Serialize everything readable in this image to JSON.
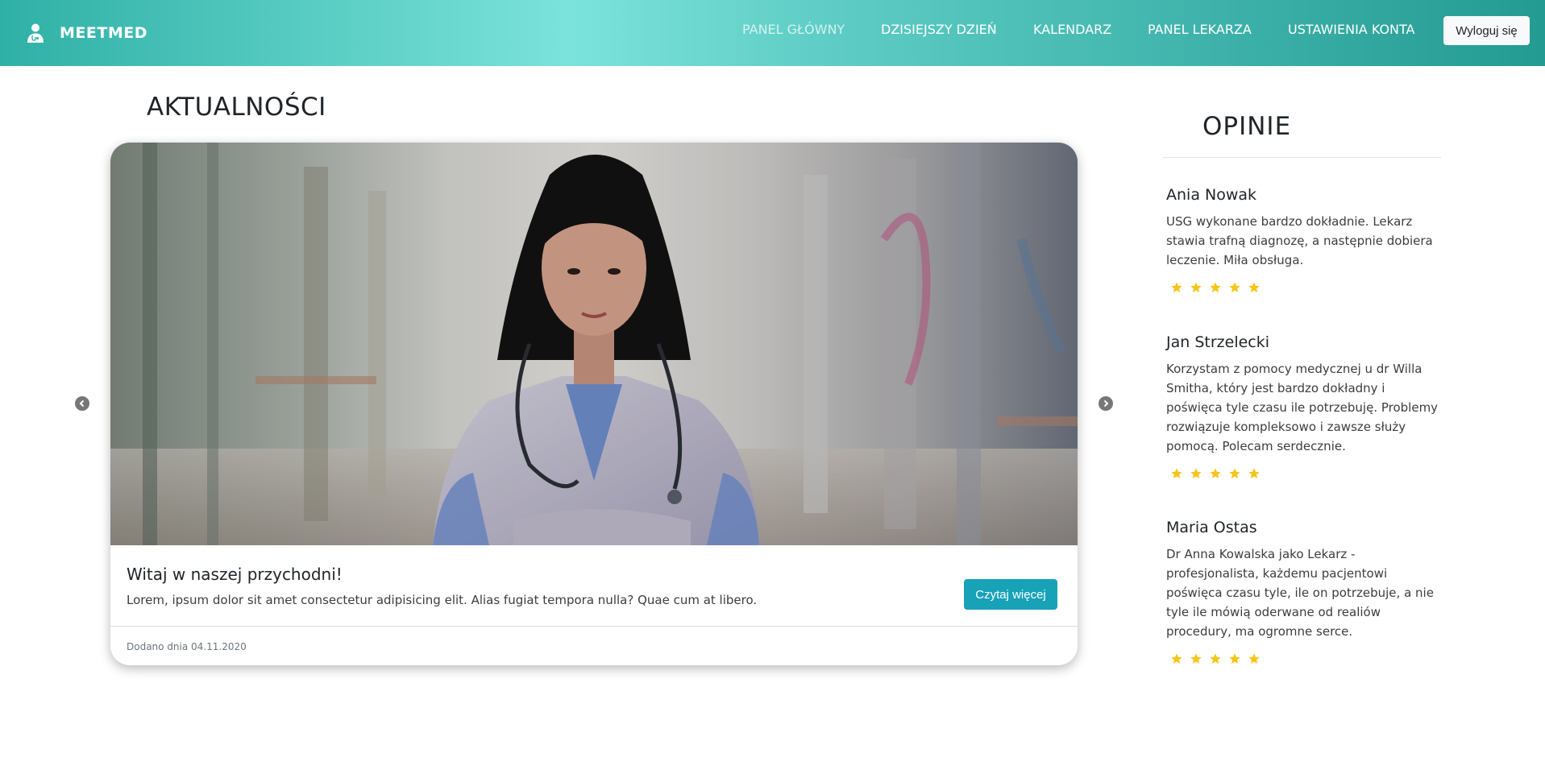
{
  "navbar": {
    "brand_icon": "doctor-icon",
    "brand_name": "MEETMED",
    "links": [
      {
        "label": "PANEL GŁÓWNY",
        "active": true
      },
      {
        "label": "DZISIEJSZY DZIEŃ",
        "active": false
      },
      {
        "label": "KALENDARZ",
        "active": false
      },
      {
        "label": "PANEL LEKARZA",
        "active": false
      },
      {
        "label": "USTAWIENIA KONTA",
        "active": false
      }
    ],
    "logout_label": "Wyloguj się",
    "colors": {
      "gradient_start": "#2fb0a6",
      "gradient_mid": "#7be3db",
      "gradient_end": "#239a92"
    }
  },
  "news": {
    "heading": "AKTUALNOŚCI",
    "card": {
      "image_alt": "doctor-photo",
      "title": "Witaj w naszej przychodni!",
      "text": "Lorem, ipsum dolor sit amet consectetur adipisicing elit. Alias fugiat tempora nulla? Quae cum at libero.",
      "button_label": "Czytaj więcej",
      "footer": "Dodano dnia 04.11.2020"
    },
    "prev_icon": "chevron-left-icon",
    "next_icon": "chevron-right-icon",
    "accent_color": "#17a2b8"
  },
  "reviews": {
    "heading": "OPINIE",
    "star_color": "#f5c518",
    "items": [
      {
        "name": "Ania Nowak",
        "text": "USG wykonane bardzo dokładnie. Lekarz stawia trafną diagnozę, a następnie dobiera leczenie. Miła obsługa.",
        "rating": 5
      },
      {
        "name": "Jan Strzelecki",
        "text": "Korzystam z pomocy medycznej u dr Willa Smitha, który jest bardzo dokładny i poświęca tyle czasu ile potrzebuję. Problemy rozwiązuje kompleksowo i zawsze służy pomocą. Polecam serdecznie.",
        "rating": 5
      },
      {
        "name": "Maria Ostas",
        "text": "Dr Anna Kowalska jako Lekarz - profesjonalista, każdemu pacjentowi poświęca czasu tyle, ile on potrzebuje, a nie tyle ile mówią oderwane od realiów procedury, ma ogromne serce.",
        "rating": 5
      }
    ]
  }
}
